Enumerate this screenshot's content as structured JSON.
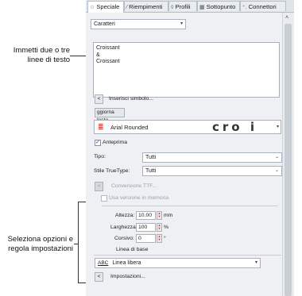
{
  "callouts": {
    "top": "Immetti due o tre linee di testo",
    "bottom": "Seleziona opzioni e regola impostazioni"
  },
  "tabs": [
    {
      "label": "Speciale",
      "icon": "star-icon"
    },
    {
      "label": "Riempimenti",
      "icon": "fill-icon"
    },
    {
      "label": "Profili",
      "icon": "profile-icon"
    },
    {
      "label": "Sottopunto",
      "icon": "underlay-icon"
    },
    {
      "label": "Connettori",
      "icon": "connector-icon"
    }
  ],
  "object_type": {
    "value": "Caratteri"
  },
  "text_area": {
    "lines": [
      "Croissant",
      "&",
      "Croissant"
    ]
  },
  "insert_symbol": {
    "btn": "<",
    "label": "Inserisci simbolo..."
  },
  "update_text": {
    "label": "ggiorna testo"
  },
  "font": {
    "name": "Arial Rounded",
    "preview": "cro i"
  },
  "preview_checkbox": {
    "label": "Anteprima",
    "checked": true
  },
  "tipo": {
    "label": "Tipo:",
    "value": "Tutti"
  },
  "truetype_style": {
    "label": "Stile TrueType:",
    "value": "Tutti"
  },
  "ttf_conversion": {
    "btn": "<",
    "label": "Conversione TTF..."
  },
  "memory_version": {
    "label": "Usa versione in memoria",
    "checked": false
  },
  "height": {
    "label": "Altezza:",
    "value": "10.00",
    "unit": "mm"
  },
  "width": {
    "label": "Larghezza:",
    "value": "100",
    "unit": "%"
  },
  "italic": {
    "label": "Corsivo:",
    "value": "0",
    "unit": "°"
  },
  "baseline": {
    "title": "Linea di base",
    "value": "Linea libera",
    "icon_text": "ABC"
  },
  "settings": {
    "btn": "<",
    "label": "Impostazioni..."
  },
  "colors": {
    "panel": "#eef0f4",
    "font_icon": "#d62f2f",
    "spinner_arrow": "#c0392b"
  }
}
